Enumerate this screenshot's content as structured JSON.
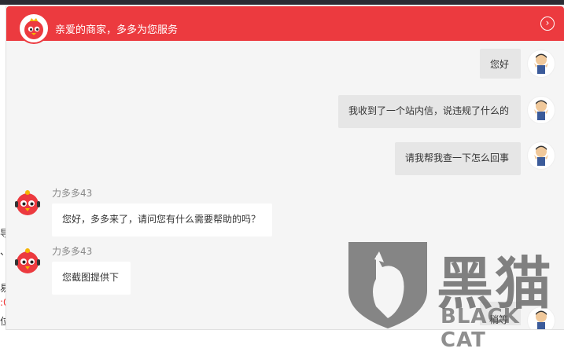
{
  "header": {
    "title": "亲爱的商家，多多为您服务",
    "close_icon": "chevron-right-icon"
  },
  "colors": {
    "brand_red": "#ec3a3f",
    "outgoing_bubble": "#e6e6e6",
    "incoming_bubble": "#ffffff",
    "chat_bg": "#f5f5f5"
  },
  "messages": [
    {
      "direction": "out",
      "text": "您好"
    },
    {
      "direction": "out",
      "text": "我收到了一个站内信，说违规了什么的"
    },
    {
      "direction": "out",
      "text": "请我帮我查一下怎么回事"
    },
    {
      "direction": "in",
      "sender": "力多多43",
      "text": "您好，多多来了，请问您有什么需要帮助的吗？"
    },
    {
      "direction": "in",
      "sender": "力多多43",
      "text": "您截图提供下"
    },
    {
      "direction": "out",
      "text": "稍等"
    }
  ],
  "watermark": {
    "text_cn": "黑猫",
    "text_en": "BLACK CAT"
  },
  "background_fragments": [
    "导",
    "、",
    "易",
    ":0",
    "位"
  ]
}
